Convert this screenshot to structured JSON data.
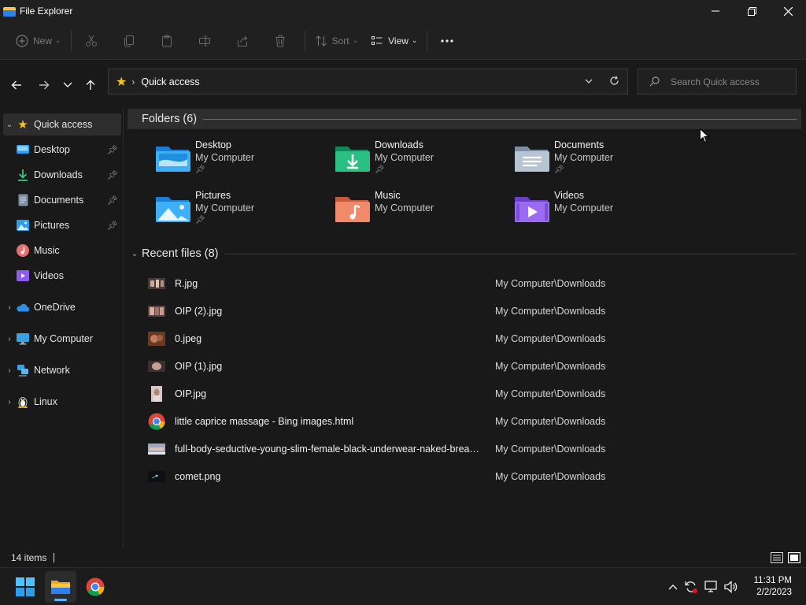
{
  "window": {
    "title": "File Explorer"
  },
  "commandbar": {
    "new_label": "New",
    "sort_label": "Sort",
    "view_label": "View"
  },
  "addressbar": {
    "path": "Quick access",
    "search_placeholder": "Search Quick access"
  },
  "sidebar": {
    "items": [
      {
        "label": "Quick access",
        "icon": "star-icon",
        "pinned": false
      },
      {
        "label": "Desktop",
        "icon": "desktop-folder-icon",
        "pinned": true
      },
      {
        "label": "Downloads",
        "icon": "download-icon",
        "pinned": true
      },
      {
        "label": "Documents",
        "icon": "document-icon",
        "pinned": true
      },
      {
        "label": "Pictures",
        "icon": "pictures-icon",
        "pinned": true
      },
      {
        "label": "Music",
        "icon": "music-icon",
        "pinned": false
      },
      {
        "label": "Videos",
        "icon": "videos-icon",
        "pinned": false
      },
      {
        "label": "OneDrive",
        "icon": "cloud-icon",
        "pinned": false
      },
      {
        "label": "My Computer",
        "icon": "computer-icon",
        "pinned": false
      },
      {
        "label": "Network",
        "icon": "network-icon",
        "pinned": false
      },
      {
        "label": "Linux",
        "icon": "linux-icon",
        "pinned": false
      }
    ]
  },
  "folders": {
    "header": "Folders (6)",
    "items": [
      {
        "name": "Desktop",
        "location": "My Computer",
        "pinned": true
      },
      {
        "name": "Downloads",
        "location": "My Computer",
        "pinned": true
      },
      {
        "name": "Documents",
        "location": "My Computer",
        "pinned": true
      },
      {
        "name": "Pictures",
        "location": "My Computer",
        "pinned": true
      },
      {
        "name": "Music",
        "location": "My Computer",
        "pinned": false
      },
      {
        "name": "Videos",
        "location": "My Computer",
        "pinned": false
      }
    ]
  },
  "recent": {
    "header": "Recent files (8)",
    "files": [
      {
        "name": "R.jpg",
        "location": "My Computer\\Downloads"
      },
      {
        "name": "OIP (2).jpg",
        "location": "My Computer\\Downloads"
      },
      {
        "name": "0.jpeg",
        "location": "My Computer\\Downloads"
      },
      {
        "name": "OIP (1).jpg",
        "location": "My Computer\\Downloads"
      },
      {
        "name": "OIP.jpg",
        "location": "My Computer\\Downloads"
      },
      {
        "name": "little caprice massage - Bing images.html",
        "location": "My Computer\\Downloads"
      },
      {
        "name": "full-body-seductive-young-slim-female-black-underwear-naked-breasts-big.jpg",
        "location": "My Computer\\Downloads"
      },
      {
        "name": "comet.png",
        "location": "My Computer\\Downloads"
      }
    ]
  },
  "status": {
    "item_count": "14 items"
  },
  "taskbar": {
    "time": "11:31 PM",
    "date": "2/2/2023"
  },
  "colors": {
    "accent": "#5fb2ff",
    "background": "#191919",
    "star": "#f5c518"
  }
}
